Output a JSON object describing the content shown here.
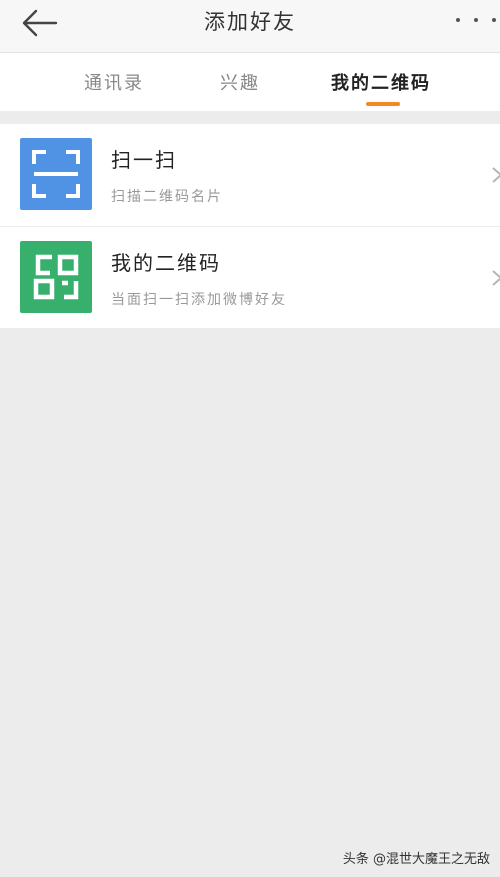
{
  "header": {
    "title": "添加好友",
    "back_icon": "arrow-left-icon",
    "more_icon": "more-dots-icon"
  },
  "tabs": [
    {
      "label": "通讯录",
      "active": false
    },
    {
      "label": "兴趣",
      "active": false
    },
    {
      "label": "我的二维码",
      "active": true
    }
  ],
  "accent_color": "#f08a24",
  "items": [
    {
      "title": "扫一扫",
      "subtitle": "扫描二维码名片",
      "icon": "scan-icon",
      "icon_color": "#5092e4"
    },
    {
      "title": "我的二维码",
      "subtitle": "当面扫一扫添加微博好友",
      "icon": "qr-code-icon",
      "icon_color": "#37b06d"
    }
  ],
  "watermark": "头条 @混世大魔王之无敌"
}
